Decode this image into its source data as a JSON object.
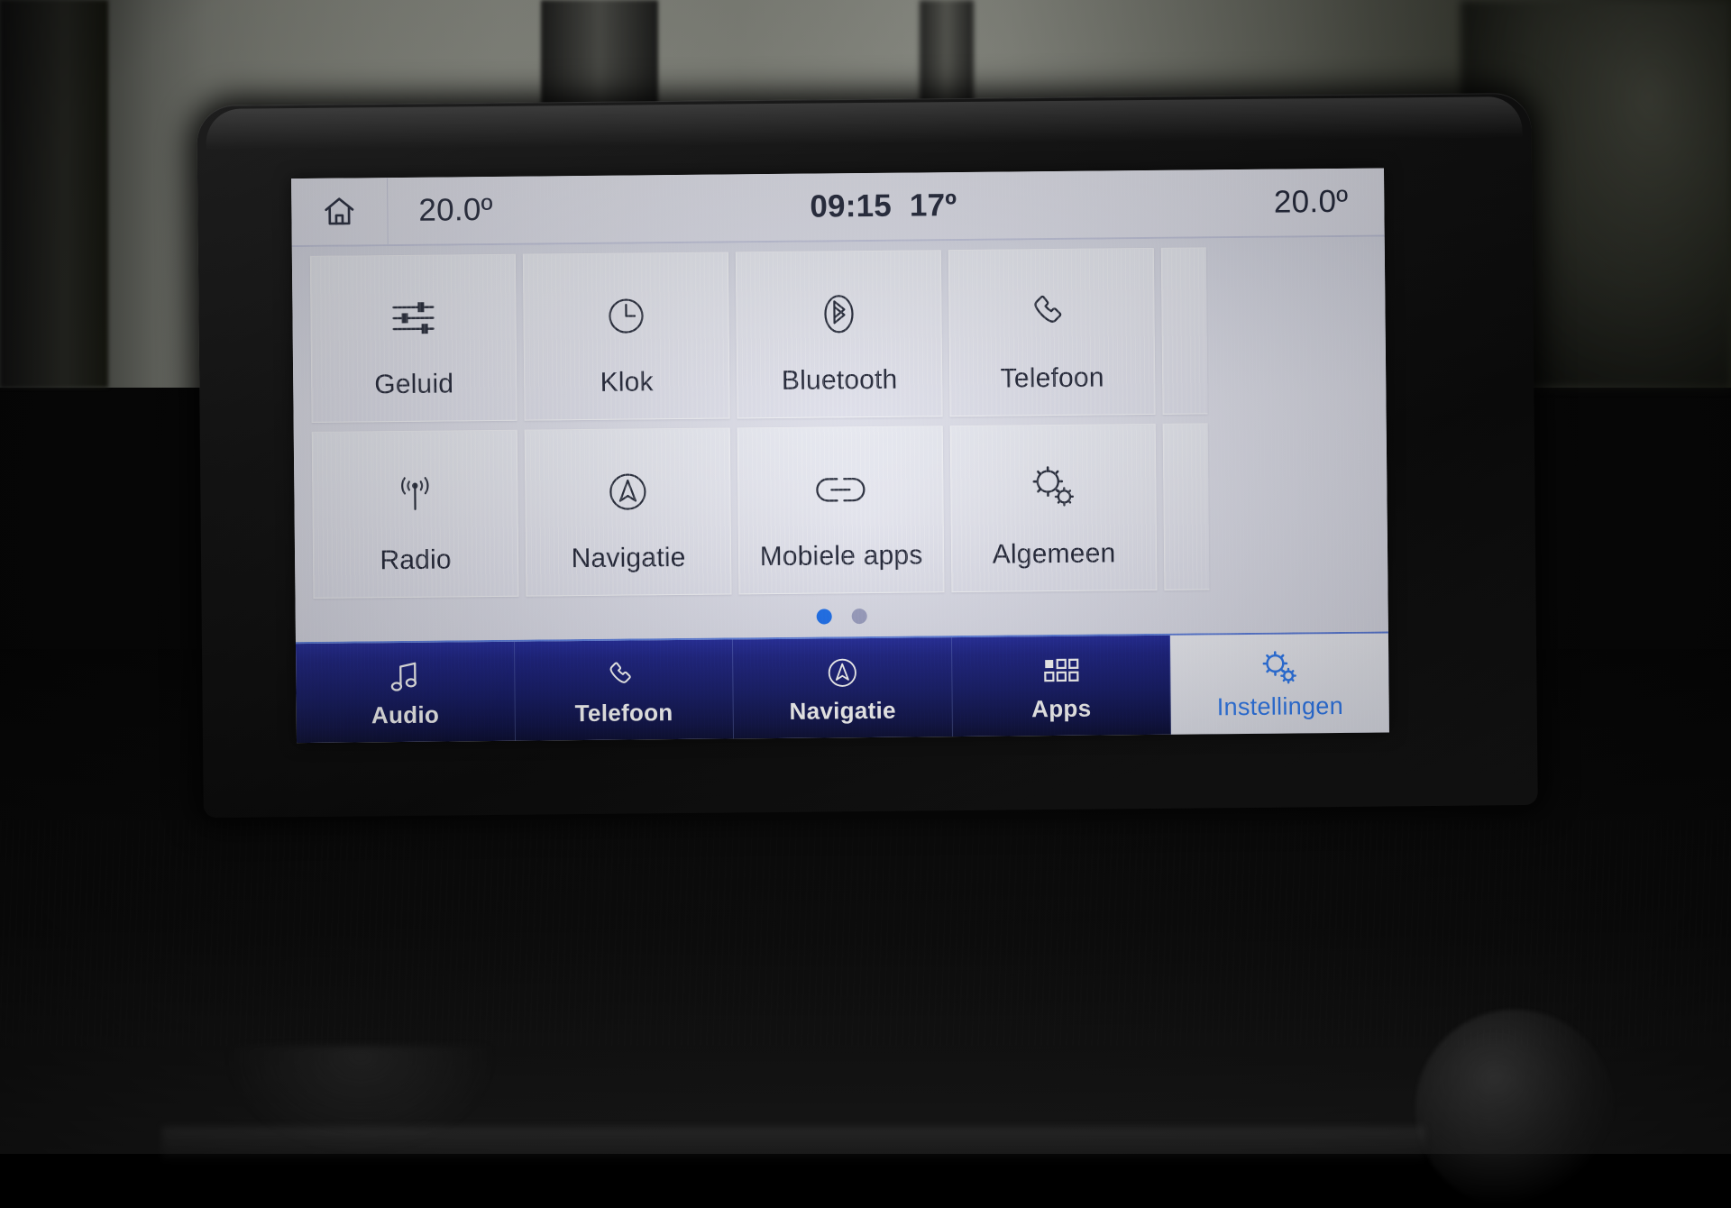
{
  "status_bar": {
    "home_icon": "home-icon",
    "left_temperature": "20.0º",
    "clock": "09:15",
    "outside_temperature": "17º",
    "right_temperature": "20.0º"
  },
  "settings_grid": {
    "tiles": [
      {
        "label": "Geluid",
        "icon": "equalizer-sliders-icon"
      },
      {
        "label": "Klok",
        "icon": "clock-icon"
      },
      {
        "label": "Bluetooth",
        "icon": "bluetooth-icon"
      },
      {
        "label": "Telefoon",
        "icon": "phone-handset-icon"
      },
      {
        "label": "Radio",
        "icon": "radio-antenna-icon"
      },
      {
        "label": "Navigatie",
        "icon": "navigation-arrow-icon"
      },
      {
        "label": "Mobiele apps",
        "icon": "link-chain-icon"
      },
      {
        "label": "Algemeen",
        "icon": "gears-icon"
      }
    ],
    "pagination": {
      "total_pages": 2,
      "current_page": 1,
      "active_color": "#1a6ef0",
      "inactive_color": "#9b9fc2"
    }
  },
  "bottom_nav": {
    "items": [
      {
        "label": "Audio",
        "icon": "music-note-icon",
        "active": false
      },
      {
        "label": "Telefoon",
        "icon": "phone-handset-icon",
        "active": false
      },
      {
        "label": "Navigatie",
        "icon": "navigation-arrow-icon",
        "active": false
      },
      {
        "label": "Apps",
        "icon": "apps-grid-icon",
        "active": false
      },
      {
        "label": "Instellingen",
        "icon": "gears-icon",
        "active": true
      }
    ],
    "accent_color": "#2f7cf6",
    "bar_color": "#141a66"
  }
}
